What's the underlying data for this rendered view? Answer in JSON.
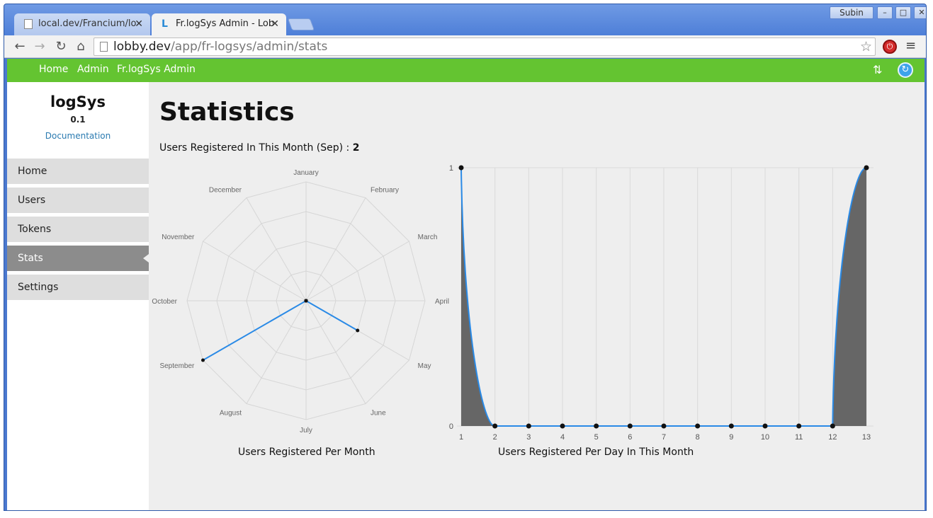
{
  "browser": {
    "tabs": [
      {
        "title": "local.dev/Francium/lo",
        "active": false
      },
      {
        "title": "Fr.logSys Admin - Lob",
        "active": true
      }
    ],
    "user": "Subin",
    "url_host": "lobby.dev",
    "url_path": "/app/fr-logsys/admin/stats",
    "close_glyph": "✕"
  },
  "appnav": {
    "links": [
      "Home",
      "Admin",
      "Fr.logSys Admin"
    ]
  },
  "sidebar": {
    "title": "logSys",
    "version": "0.1",
    "doc_link": "Documentation",
    "items": [
      {
        "label": "Home",
        "active": false
      },
      {
        "label": "Users",
        "active": false
      },
      {
        "label": "Tokens",
        "active": false
      },
      {
        "label": "Stats",
        "active": true
      },
      {
        "label": "Settings",
        "active": false
      }
    ]
  },
  "main": {
    "title": "Statistics",
    "summary_label": "Users Registered In This Month (Sep) : ",
    "summary_value": "2"
  },
  "colors": {
    "accent_green": "#64c431",
    "line_blue": "#2a8ae6",
    "area_fill": "#666666"
  },
  "chart_data": [
    {
      "type": "radar",
      "title": "Users Registered Per Month",
      "categories": [
        "January",
        "February",
        "March",
        "April",
        "May",
        "June",
        "July",
        "August",
        "September",
        "October",
        "November",
        "December"
      ],
      "values": [
        0,
        0,
        0,
        0,
        0.5,
        0,
        0,
        0,
        1,
        0,
        0,
        0
      ],
      "rmax": 1
    },
    {
      "type": "area",
      "title": "Users Registered Per Day In This Month",
      "x": [
        1,
        2,
        3,
        4,
        5,
        6,
        7,
        8,
        9,
        10,
        11,
        12,
        13
      ],
      "values": [
        1,
        0,
        0,
        0,
        0,
        0,
        0,
        0,
        0,
        0,
        0,
        0,
        1
      ],
      "yticks": [
        0,
        1
      ],
      "ylim": [
        0,
        1
      ],
      "grid": true
    }
  ]
}
